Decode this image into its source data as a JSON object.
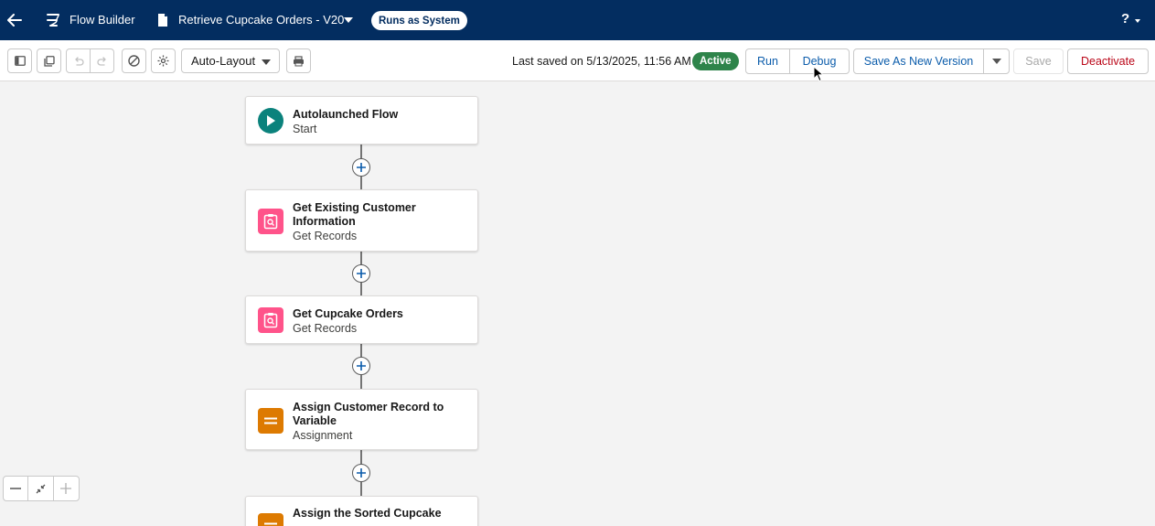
{
  "header": {
    "app_name": "Flow Builder",
    "flow_name": "Retrieve Cupcake Orders - V20",
    "runs_as": "Runs as System",
    "help": "?"
  },
  "toolbar": {
    "layout_select": "Auto-Layout",
    "last_saved": "Last saved on 5/13/2025, 11:56 AM",
    "status": "Active",
    "run_label": "Run",
    "debug_label": "Debug",
    "save_new_label": "Save As New Version",
    "save_label": "Save",
    "deactivate_label": "Deactivate"
  },
  "nodes": [
    {
      "title": "Autolaunched Flow",
      "subtitle": "Start",
      "icon": "play-icon",
      "color": "#0b827c"
    },
    {
      "title": "Get Existing Customer Information",
      "subtitle": "Get Records",
      "icon": "record-search-icon",
      "color": "#ff538a"
    },
    {
      "title": "Get Cupcake Orders",
      "subtitle": "Get Records",
      "icon": "record-search-icon",
      "color": "#ff538a"
    },
    {
      "title": "Assign Customer Record to Variable",
      "subtitle": "Assignment",
      "icon": "assignment-icon",
      "color": "#dd7a01"
    },
    {
      "title": "Assign the Sorted Cupcake",
      "subtitle": "",
      "icon": "assignment-icon",
      "color": "#dd7a01"
    }
  ]
}
